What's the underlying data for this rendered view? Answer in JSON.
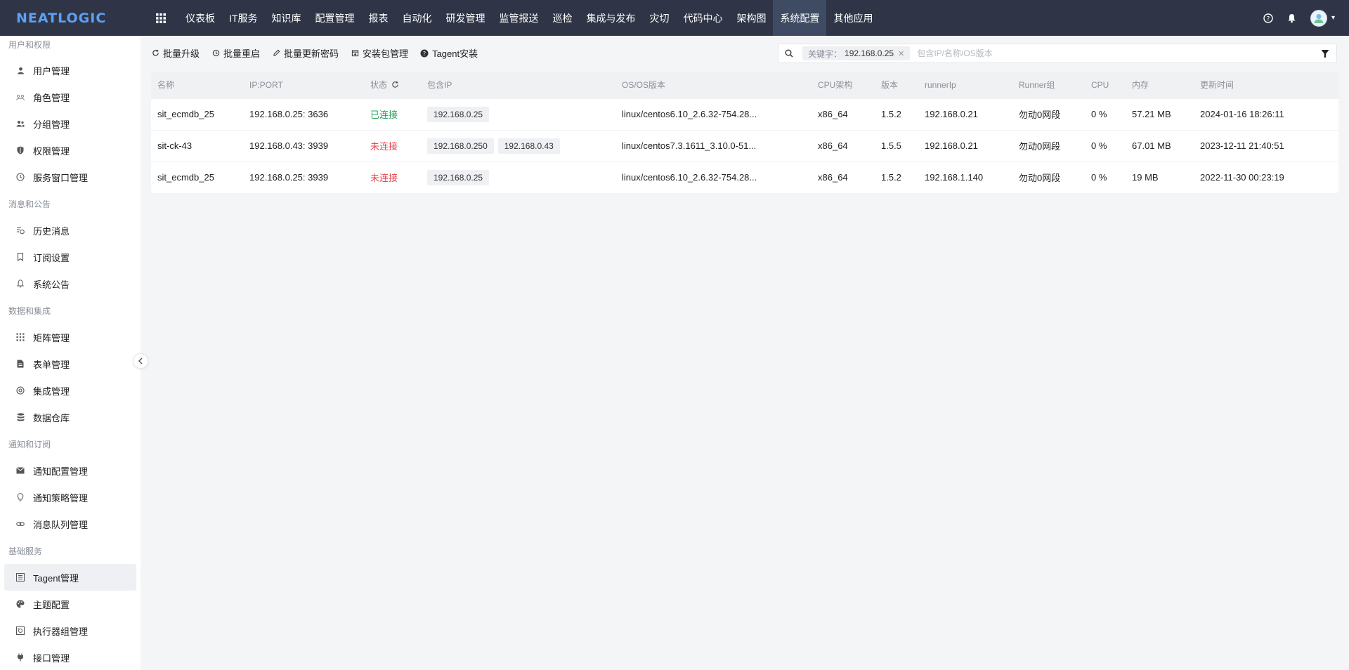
{
  "topbar": {
    "logo": "NEATLOGIC",
    "nav": [
      "仪表板",
      "IT服务",
      "知识库",
      "配置管理",
      "报表",
      "自动化",
      "研发管理",
      "监管报送",
      "巡检",
      "集成与发布",
      "灾切",
      "代码中心",
      "架构图",
      "系统配置",
      "其他应用"
    ],
    "active_nav": "系统配置"
  },
  "sidebar": {
    "groups": [
      {
        "title": "用户和权限",
        "items": [
          {
            "label": "用户管理",
            "icon": "user-icon"
          },
          {
            "label": "角色管理",
            "icon": "role-icon"
          },
          {
            "label": "分组管理",
            "icon": "group-icon"
          },
          {
            "label": "权限管理",
            "icon": "shield-icon"
          },
          {
            "label": "服务窗口管理",
            "icon": "clock-icon"
          }
        ]
      },
      {
        "title": "消息和公告",
        "items": [
          {
            "label": "历史消息",
            "icon": "history-icon"
          },
          {
            "label": "订阅设置",
            "icon": "bookmark-icon"
          },
          {
            "label": "系统公告",
            "icon": "bell-icon"
          }
        ]
      },
      {
        "title": "数据和集成",
        "items": [
          {
            "label": "矩阵管理",
            "icon": "matrix-icon"
          },
          {
            "label": "表单管理",
            "icon": "form-icon"
          },
          {
            "label": "集成管理",
            "icon": "integration-icon"
          },
          {
            "label": "数据仓库",
            "icon": "database-icon"
          }
        ]
      },
      {
        "title": "通知和订阅",
        "items": [
          {
            "label": "通知配置管理",
            "icon": "mail-icon"
          },
          {
            "label": "通知策略管理",
            "icon": "lightbulb-icon"
          },
          {
            "label": "消息队列管理",
            "icon": "link-icon"
          }
        ]
      },
      {
        "title": "基础服务",
        "items": [
          {
            "label": "Tagent管理",
            "icon": "tagent-icon",
            "active": true
          },
          {
            "label": "主题配置",
            "icon": "palette-icon"
          },
          {
            "label": "执行器组管理",
            "icon": "runner-icon"
          },
          {
            "label": "接口管理",
            "icon": "plug-icon"
          }
        ]
      }
    ]
  },
  "toolbar": {
    "batch_upgrade": "批量升级",
    "batch_restart": "批量重启",
    "batch_update_password": "批量更新密码",
    "package_manage": "安装包管理",
    "tagent_install": "Tagent安装"
  },
  "search": {
    "tag_key": "关键字：",
    "tag_value": "192.168.0.25",
    "placeholder": "包含IP/名称/OS版本"
  },
  "table": {
    "columns": [
      "名称",
      "IP:PORT",
      "状态",
      "包含IP",
      "OS/OS版本",
      "CPU架构",
      "版本",
      "runnerIp",
      "Runner组",
      "CPU",
      "内存",
      "更新时间"
    ],
    "rows": [
      {
        "name": "sit_ecmdb_25",
        "ipport": "192.168.0.25: 3636",
        "status": "已连接",
        "status_ok": true,
        "ips": [
          "192.168.0.25"
        ],
        "os": "linux/centos6.10_2.6.32-754.28...",
        "arch": "x86_64",
        "version": "1.5.2",
        "runner_ip": "192.168.0.21",
        "runner_group": "勿动0网段",
        "cpu": "0 %",
        "mem": "57.21 MB",
        "updated": "2024-01-16 18:26:11"
      },
      {
        "name": "sit-ck-43",
        "ipport": "192.168.0.43: 3939",
        "status": "未连接",
        "status_ok": false,
        "ips": [
          "192.168.0.250",
          "192.168.0.43"
        ],
        "os": "linux/centos7.3.1611_3.10.0-51...",
        "arch": "x86_64",
        "version": "1.5.5",
        "runner_ip": "192.168.0.21",
        "runner_group": "勿动0网段",
        "cpu": "0 %",
        "mem": "67.01 MB",
        "updated": "2023-12-11 21:40:51"
      },
      {
        "name": "sit_ecmdb_25",
        "ipport": "192.168.0.25: 3939",
        "status": "未连接",
        "status_ok": false,
        "ips": [
          "192.168.0.25"
        ],
        "os": "linux/centos6.10_2.6.32-754.28...",
        "arch": "x86_64",
        "version": "1.5.2",
        "runner_ip": "192.168.1.140",
        "runner_group": "勿动0网段",
        "cpu": "0 %",
        "mem": "19 MB",
        "updated": "2022-11-30 00:23:19"
      }
    ]
  },
  "colors": {
    "topbar_bg": "#2f3546",
    "logo": "#5da0f5",
    "status_ok": "#25a35a",
    "status_bad": "#e5484d"
  }
}
